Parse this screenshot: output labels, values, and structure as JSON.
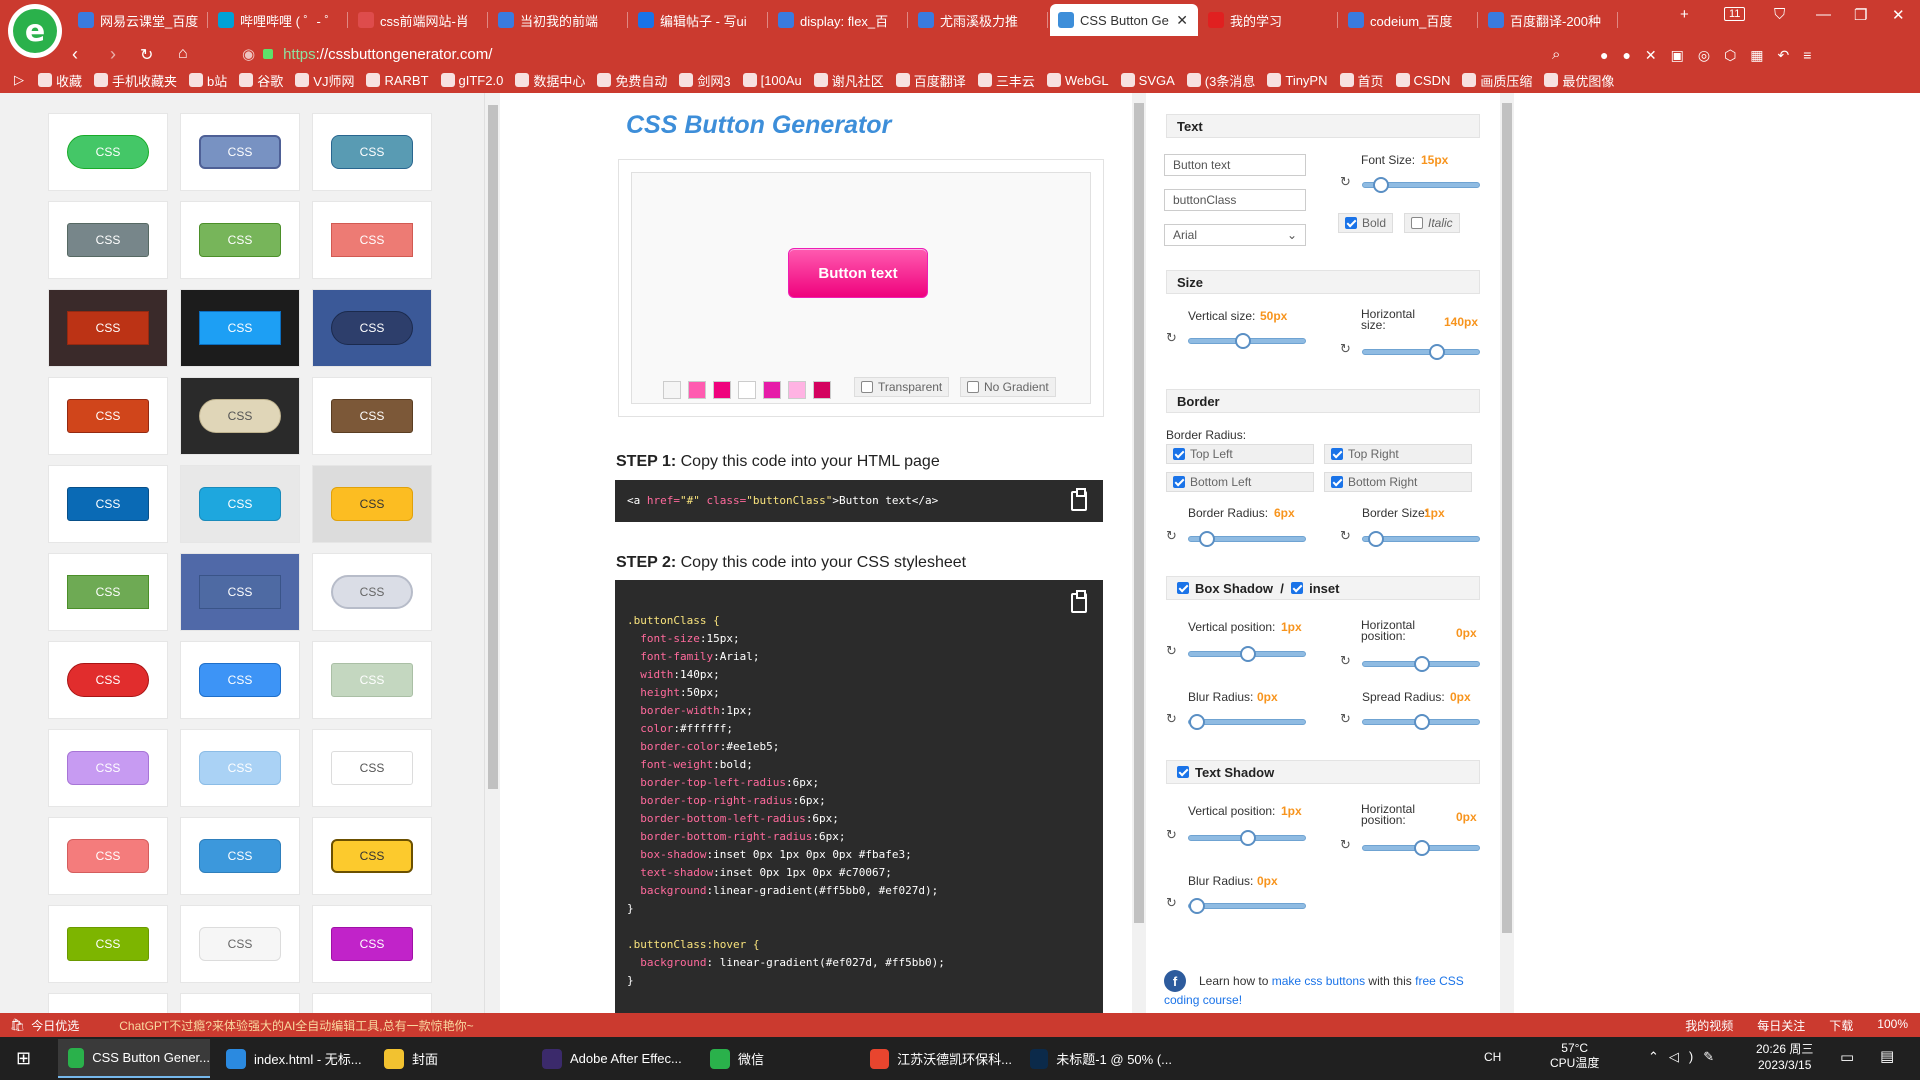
{
  "browser": {
    "tabs": [
      {
        "label": "网易云课堂_百度",
        "color": "#3a7be0"
      },
      {
        "label": "哔哩哔哩 ( ゜- ゜",
        "color": "#00a1d6"
      },
      {
        "label": "css前端网站-肖",
        "color": "#de4c4c"
      },
      {
        "label": "当初我的前端",
        "color": "#3a7be0"
      },
      {
        "label": "编辑帖子 - 写ui",
        "color": "#1a73e8"
      },
      {
        "label": "display: flex_百",
        "color": "#3a7be0"
      },
      {
        "label": "尤雨溪极力推",
        "color": "#3a7be0"
      },
      {
        "label": "CSS Button Ge",
        "color": "#3d8ed9"
      },
      {
        "label": "我的学习",
        "color": "#e02020"
      },
      {
        "label": "codeium_百度",
        "color": "#3a7be0"
      },
      {
        "label": "百度翻译-200种",
        "color": "#3a7be0"
      }
    ],
    "tab_count": "11",
    "url_scheme": "https",
    "url_rest": "://cssbuttongenerator.com/",
    "bookmarks": [
      "收藏",
      "手机收藏夹",
      "b站",
      "谷歌",
      "VJ师网",
      "RARBT",
      "gITF2.0",
      "数据中心",
      "免费自动",
      "剑网3",
      "[100Au",
      "谢凡社区",
      "百度翻译",
      "三丰云",
      "WebGL",
      "SVGA",
      "(3条消息",
      "TinyPN",
      "首页",
      "CSDN",
      "画质压缩",
      "最优图像"
    ]
  },
  "gallery": {
    "label": "css",
    "buttons": [
      {
        "bg": "#44c767",
        "fg": "#fff",
        "r": "18px",
        "border": "1px solid #18ab29"
      },
      {
        "bg": "#7892c2",
        "fg": "#fff",
        "r": "6px",
        "border": "2px solid #4e6096"
      },
      {
        "bg": "#599bb3",
        "fg": "#fff",
        "r": "8px",
        "border": "1px solid #29668f"
      },
      {
        "bg": "#77868a",
        "fg": "#fff",
        "r": "3px",
        "border": "1px solid #566963"
      },
      {
        "bg": "#77b55a",
        "fg": "#fff",
        "r": "4px",
        "border": "1px solid #4b8f29"
      },
      {
        "bg": "#ed7b74",
        "fg": "#fff",
        "r": "0",
        "border": "1px solid #d15a52"
      },
      {
        "bg": "#bc3315",
        "fg": "#fff",
        "r": "0",
        "border": "1px solid #942911",
        "cell": "#3a2a2a"
      },
      {
        "bg": "#1d9ff4",
        "fg": "#fff",
        "r": "0",
        "border": "1px solid #0b6ebf",
        "cell": "#1c1c1c"
      },
      {
        "bg": "#2d3e6b",
        "fg": "#fff",
        "r": "18px",
        "border": "1px solid #1b2a4d",
        "cell": "#3b5998"
      },
      {
        "bg": "#d0451b",
        "fg": "#fff",
        "r": "3px",
        "border": "1px solid #942911"
      },
      {
        "bg": "#e0d6b8",
        "fg": "#555",
        "r": "18px",
        "border": "1px solid #bfb38f",
        "cell": "#2a2a2a"
      },
      {
        "bg": "#7c5838",
        "fg": "#fff",
        "r": "3px",
        "border": "1px solid #5a3d22"
      },
      {
        "bg": "#0a6ab5",
        "fg": "#fff",
        "r": "3px",
        "border": "1px solid #084f88"
      },
      {
        "bg": "#1ea7de",
        "fg": "#fff",
        "r": "6px",
        "border": "1px solid #1a8bbb",
        "cell": "#e8e8e8"
      },
      {
        "bg": "#fcbd22",
        "fg": "#333",
        "r": "6px",
        "border": "1px solid #e0a10a",
        "cell": "#dcdcdc"
      },
      {
        "bg": "#6eaa54",
        "fg": "#fff",
        "r": "0",
        "border": "1px solid #4b8f29"
      },
      {
        "bg": "#4e6aa3",
        "fg": "#fff",
        "r": "0",
        "border": "1px solid #3a5488",
        "cell": "#5069a8"
      },
      {
        "bg": "#dadde6",
        "fg": "#666",
        "r": "18px",
        "border": "2px solid #b7bcc9"
      },
      {
        "bg": "#e12d2d",
        "fg": "#fff",
        "r": "18px",
        "border": "1px solid #a81414"
      },
      {
        "bg": "#3d94f6",
        "fg": "#fff",
        "r": "6px",
        "border": "1px solid #1f6fc9"
      },
      {
        "bg": "#c4d7c0",
        "fg": "#fff",
        "r": "3px",
        "border": "1px solid #aabfa5"
      },
      {
        "bg": "#c79bf2",
        "fg": "#fff",
        "r": "6px",
        "border": "1px solid #a775d6"
      },
      {
        "bg": "#aad2f5",
        "fg": "#fff",
        "r": "6px",
        "border": "1px solid #8bbce6"
      },
      {
        "bg": "#ffffff",
        "fg": "#555",
        "r": "3px",
        "border": "1px solid #dcdcdc"
      },
      {
        "bg": "#f47c7c",
        "fg": "#fff",
        "r": "6px",
        "border": "1px solid #d45d5d"
      },
      {
        "bg": "#3c98dc",
        "fg": "#fff",
        "r": "6px",
        "border": "1px solid #2f7fbc"
      },
      {
        "bg": "#fcca2d",
        "fg": "#333",
        "r": "6px",
        "border": "2px solid #6b5000"
      },
      {
        "bg": "#7db500",
        "fg": "#fff",
        "r": "3px",
        "border": "1px solid #6a9900"
      },
      {
        "bg": "#f6f6f6",
        "fg": "#666",
        "r": "6px",
        "border": "1px solid #dcdcdc"
      },
      {
        "bg": "#c123c9",
        "fg": "#fff",
        "r": "3px",
        "border": "1px solid #a010a6"
      }
    ]
  },
  "main": {
    "title": "CSS Button Generator",
    "preview_button": "Button text",
    "swatches": [
      "#f5f5f5",
      "#ff5bb0",
      "#ef027d",
      "#ffffff",
      "#e61ca8",
      "#ffb3e3",
      "#d4025f"
    ],
    "transparent_label": "Transparent",
    "no_gradient_label": "No Gradient",
    "step1_num": "STEP 1:",
    "step1_text": " Copy this code into your HTML page",
    "step2_num": "STEP 2:",
    "step2_text": " Copy this code into your CSS stylesheet",
    "html_code": {
      "open": "<a ",
      "href_attr": "href=",
      "href_val": "\"#\"",
      "class_attr": " class=",
      "class_val": "\"buttonClass\"",
      "close": ">Button text</a>"
    },
    "css_lines": [
      {
        "t": ".buttonClass {",
        "c": "sel"
      },
      {
        "p": "  font-size",
        "v": ":15px;"
      },
      {
        "p": "  font-family",
        "v": ":Arial;"
      },
      {
        "p": "  width",
        "v": ":140px;"
      },
      {
        "p": "  height",
        "v": ":50px;"
      },
      {
        "p": "  border-width",
        "v": ":1px;"
      },
      {
        "p": "  color",
        "v": ":#ffffff;"
      },
      {
        "p": "  border-color",
        "v": ":#ee1eb5;"
      },
      {
        "p": "  font-weight",
        "v": ":bold;"
      },
      {
        "p": "  border-top-left-radius",
        "v": ":6px;"
      },
      {
        "p": "  border-top-right-radius",
        "v": ":6px;"
      },
      {
        "p": "  border-bottom-left-radius",
        "v": ":6px;"
      },
      {
        "p": "  border-bottom-right-radius",
        "v": ":6px;"
      },
      {
        "p": "  box-shadow",
        "v": ":inset 0px 1px 0px 0px #fbafe3;"
      },
      {
        "p": "  text-shadow",
        "v": ":inset 0px 1px 0px #c70067;"
      },
      {
        "p": "  background",
        "v": ":linear-gradient(#ff5bb0, #ef027d);"
      },
      {
        "t": "}",
        "c": "val"
      },
      {
        "t": " ",
        "c": "val"
      },
      {
        "t": ".buttonClass:hover {",
        "c": "sel"
      },
      {
        "p": "  background",
        "v": ": linear-gradient(#ef027d, #ff5bb0);"
      },
      {
        "t": "}",
        "c": "val"
      }
    ]
  },
  "panel": {
    "text_section": "Text",
    "button_text_value": "Button text",
    "class_value": "buttonClass",
    "font_family": "Arial",
    "font_size_label": "Font Size:",
    "font_size": "15px",
    "bold": "Bold",
    "italic": "Italic",
    "size_section": "Size",
    "vertical_size_label": "Vertical size:",
    "vertical_size": "50px",
    "horizontal_size_label": "Horizontal size:",
    "horizontal_size": "140px",
    "border_section": "Border",
    "border_radius_label": "Border Radius:",
    "top_left": "Top Left",
    "top_right": "Top Right",
    "bottom_left": "Bottom Left",
    "bottom_right": "Bottom Right",
    "border_radius_value_label": "Border Radius:",
    "border_radius": "6px",
    "border_size_label": "Border Size:",
    "border_size": "1px",
    "box_shadow": "Box Shadow",
    "inset": "inset",
    "bs_vertical_label": "Vertical position:",
    "bs_vertical": "1px",
    "bs_horizontal_label": "Horizontal position:",
    "bs_horizontal": "0px",
    "bs_blur_label": "Blur Radius:",
    "bs_blur": "0px",
    "bs_spread_label": "Spread Radius:",
    "bs_spread": "0px",
    "text_shadow": "Text Shadow",
    "ts_vertical_label": "Vertical position:",
    "ts_vertical": "1px",
    "ts_horizontal_label": "Horizontal position:",
    "ts_horizontal": "0px",
    "ts_blur_label": "Blur Radius:",
    "ts_blur": "0px",
    "learn_pre": "Learn how to ",
    "learn_link1": "make css buttons",
    "learn_mid": " with this ",
    "learn_link2": "free CSS coding course!"
  },
  "statusbar": {
    "left": "今日优选",
    "news": "ChatGPT不过瘾?来体验强大的AI全自动编辑工具,总有一款惊艳你~",
    "right_items": [
      "我的视频",
      "每日关注",
      "下载",
      "100%"
    ]
  },
  "taskbar": {
    "apps": [
      {
        "label": "CSS Button Gener...",
        "color": "#2ab14b"
      },
      {
        "label": "index.html - 无标...",
        "color": "#2b8ae0"
      },
      {
        "label": "封面",
        "color": "#f2c230"
      },
      {
        "label": "Adobe After Effec...",
        "color": "#3b2a6b"
      },
      {
        "label": "微信",
        "color": "#2ab14b"
      },
      {
        "label": "江苏沃德凯环保科...",
        "color": "#e8452e"
      },
      {
        "label": "未标题-1 @ 50% (...",
        "color": "#0b2a4a"
      }
    ],
    "temp": "57°C",
    "cpu": "CPU温度",
    "time": "20:26 周三",
    "date": "2023/3/15",
    "ime": "CH"
  }
}
